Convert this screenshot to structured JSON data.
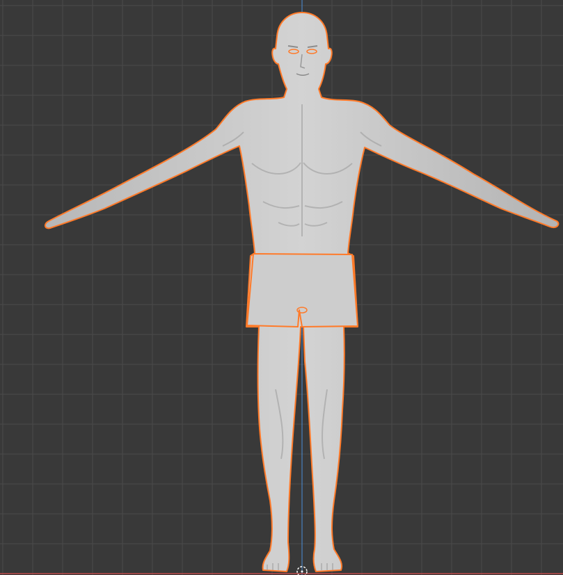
{
  "viewport": {
    "view": "front-orthographic",
    "background_color": "#393939",
    "grid_color": "#4a4a4a",
    "axis_z_color": "#4a90d9",
    "axis_x_color": "#c04a4a",
    "selection_outline_color": "#ff7a29",
    "mesh_color": "#c9c9c9",
    "mesh_shade_color": "#a9a9a9",
    "object": {
      "name": "male-base-mesh",
      "pose": "A-pose",
      "selected": true,
      "parts": [
        "body",
        "shorts"
      ]
    },
    "icons": {
      "origin": "3d-cursor-icon"
    }
  }
}
